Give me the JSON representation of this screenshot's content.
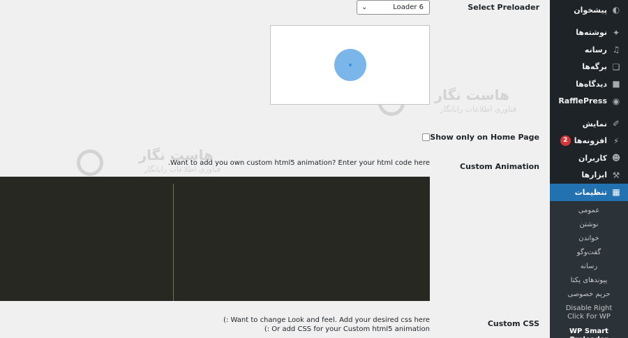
{
  "sidebar": {
    "items": [
      {
        "label": "پیشخوان",
        "icon": "dashboard-icon"
      },
      {
        "label": "نوشته‌ها",
        "icon": "pin-icon"
      },
      {
        "label": "رسانه",
        "icon": "media-icon"
      },
      {
        "label": "برگه‌ها",
        "icon": "pages-icon"
      },
      {
        "label": "دیدگاه‌ها",
        "icon": "comments-icon"
      },
      {
        "label": "RafflePress",
        "icon": "rafflepress-icon"
      },
      {
        "label": "نمایش",
        "icon": "appearance-icon"
      },
      {
        "label": "افزونه‌ها",
        "icon": "plugins-icon",
        "badge": "2"
      },
      {
        "label": "کاربران",
        "icon": "users-icon"
      },
      {
        "label": "ابزارها",
        "icon": "tools-icon"
      },
      {
        "label": "تنظیمات",
        "icon": "settings-icon",
        "active": true
      }
    ],
    "submenu": [
      "عمومی",
      "نوشتن",
      "خواندن",
      "گفت‌وگو",
      "رسانه",
      "پیوندهای یکتا",
      "حریم خصوصی",
      "Disable Right Click For WP",
      "WP Smart Preloader"
    ]
  },
  "form": {
    "select_preloader_label": "Select Preloader",
    "select_value": "Loader 6",
    "home_page_label": "Show only on Home Page",
    "custom_animation_label": "Custom Animation",
    "custom_animation_desc": "Want to add you own custom html5 animation? Enter your html code here.",
    "custom_css_label": "Custom CSS",
    "custom_css_desc_1": "Want to change Look and feel. Add your desired css here :)",
    "custom_css_desc_2": "Or add CSS for your Custom html5 animation :)"
  },
  "watermark": {
    "title": "هاست نگار",
    "subtitle": "فناوری اطلاعات رایانگار"
  },
  "colors": {
    "sidebar_bg": "#1d2327",
    "active_bg": "#2271b1",
    "badge": "#d63638",
    "editor_bg": "#272822",
    "preloader_circle": "#7ab6ea"
  }
}
